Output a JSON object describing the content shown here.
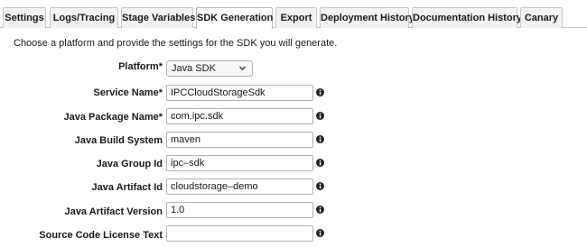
{
  "tabs": [
    {
      "label": "Settings",
      "active": false
    },
    {
      "label": "Logs/Tracing",
      "active": false
    },
    {
      "label": "Stage Variables",
      "active": false
    },
    {
      "label": "SDK Generation",
      "active": true
    },
    {
      "label": "Export",
      "active": false
    },
    {
      "label": "Deployment History",
      "active": false
    },
    {
      "label": "Documentation History",
      "active": false
    },
    {
      "label": "Canary",
      "active": false
    }
  ],
  "intro": "Choose a platform and provide the settings for the SDK you will generate.",
  "platform": {
    "label": "Platform*",
    "selected": "Java SDK",
    "icon": "chevron-down-icon"
  },
  "fields": [
    {
      "label": "Service Name*",
      "value": "IPCCloudStorageSdk",
      "icon": "info-icon"
    },
    {
      "label": "Java Package Name*",
      "value": "com.ipc.sdk",
      "icon": "info-icon"
    },
    {
      "label": "Java Build System",
      "value": "maven",
      "icon": "info-icon"
    },
    {
      "label": "Java Group Id",
      "value": "ipc–sdk",
      "icon": "info-icon"
    },
    {
      "label": "Java Artifact Id",
      "value": "cloudstorage–demo",
      "icon": "info-icon"
    },
    {
      "label": "Java Artifact Version",
      "value": "1.0",
      "icon": "info-icon"
    },
    {
      "label": "Source Code License Text",
      "value": "",
      "icon": "info-icon"
    }
  ]
}
